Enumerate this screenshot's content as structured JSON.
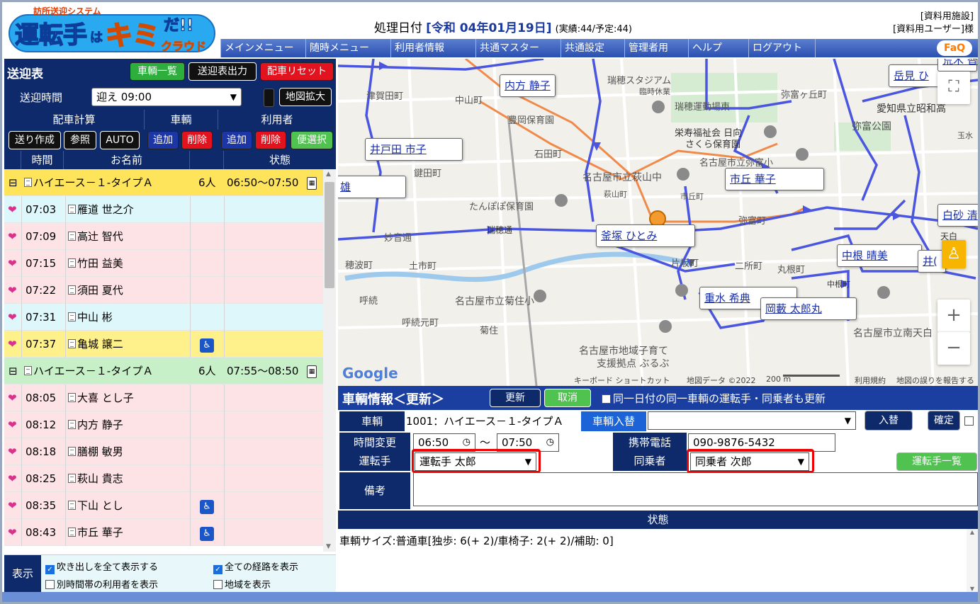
{
  "header": {
    "logo_small": "訪所送迎システム",
    "logo_main_1": "運転手",
    "logo_main_2": "は",
    "logo_main_3": "キミ",
    "logo_main_4": "だ!!",
    "logo_cloud": "クラウド",
    "date_label": "処理日付",
    "date_value": "[令和 04年01月19日]",
    "date_sub": "(実績:44/予定:44)",
    "facility": "[資料用施設]",
    "user": "[資料用ユーザー]様",
    "faq": "FaQ"
  },
  "menu": [
    "メインメニュー",
    "随時メニュー",
    "利用者情報",
    "共通マスター",
    "共通設定",
    "管理者用",
    "ヘルプ",
    "ログアウト"
  ],
  "schedule": {
    "title": "送迎表",
    "btn_vehicle_list": "車輌一覧",
    "btn_output": "送迎表出力",
    "btn_reset": "配車リセット",
    "time_label": "送迎時間",
    "time_value": "迎え 09:00",
    "btn_map_zoom": "地図拡大",
    "calc_label": "配車計算",
    "vehicle_label": "車輌",
    "user_label": "利用者",
    "btn_send": "送り作成",
    "btn_ref": "参照",
    "btn_auto": "AUTO",
    "btn_veh_add": "追加",
    "btn_veh_del": "削除",
    "btn_user_add": "追加",
    "btn_user_del": "削除",
    "btn_convenient": "便選択",
    "col_time": "時間",
    "col_name": "お名前",
    "col_status": "状態",
    "rows": [
      {
        "type": "vehicle",
        "expand": "⊟",
        "name": "ハイエース－１-タイプＡ",
        "count": "6人",
        "status": "06:50～07:50"
      },
      {
        "type": "user",
        "time": "07:03",
        "name": "雁道 世之介",
        "wheel": ""
      },
      {
        "type": "user",
        "time": "07:09",
        "name": "高辻 智代",
        "wheel": ""
      },
      {
        "type": "user",
        "time": "07:15",
        "name": "竹田 益美",
        "wheel": ""
      },
      {
        "type": "user",
        "time": "07:22",
        "name": "須田 夏代",
        "wheel": ""
      },
      {
        "type": "user",
        "time": "07:31",
        "name": "中山 彬",
        "wheel": ""
      },
      {
        "type": "user",
        "time": "07:37",
        "name": "亀城 譲二",
        "wheel": "♿"
      },
      {
        "type": "vehicle",
        "expand": "⊟",
        "name": "ハイエース－１-タイプＡ",
        "count": "6人",
        "status": "07:55～08:50"
      },
      {
        "type": "user",
        "time": "08:05",
        "name": "大喜 とし子",
        "wheel": ""
      },
      {
        "type": "user",
        "time": "08:12",
        "name": "内方 静子",
        "wheel": ""
      },
      {
        "type": "user",
        "time": "08:18",
        "name": "膳棚 敏男",
        "wheel": ""
      },
      {
        "type": "user",
        "time": "08:25",
        "name": "萩山 貴志",
        "wheel": ""
      },
      {
        "type": "user",
        "time": "08:35",
        "name": "下山 とし",
        "wheel": "♿"
      },
      {
        "type": "user",
        "time": "08:43",
        "name": "市丘 華子",
        "wheel": "♿"
      }
    ],
    "display_label": "表示",
    "opt_show_bubbles": "吹き出しを全て表示する",
    "opt_show_routes": "全ての経路を表示",
    "opt_other_time_users": "別時間帯の利用者を表示",
    "opt_show_areas": "地域を表示"
  },
  "map": {
    "pins": [
      "内方 静子",
      "井戸田 市子",
      "雄",
      "市丘 華子",
      "釜塚 ひとみ",
      "中根 晴美",
      "重水 希典",
      "岡藪 太郎丸",
      "岳見 ひ",
      "白砂 清",
      "井(",
      "荒木 智"
    ],
    "labels": [
      "瑞穂スタジアム",
      "臨時休業",
      "瑞穂運動場東",
      "弥富ヶ丘町",
      "愛知県立昭和高",
      "弥富公園",
      "津賀田町",
      "中山町",
      "豊岡保育園",
      "栄寿福祉会 日向",
      "さくら保育園",
      "石田町",
      "鍵田町",
      "名古屋市立弥富小",
      "名古屋市立萩山中",
      "萩山町",
      "市丘町",
      "たんぽぽ保育園",
      "弥富町",
      "瑞穂通",
      "妙音通",
      "土市町",
      "片坂町",
      "二所町",
      "丸根町",
      "中根町",
      "穂波町",
      "呼続",
      "呼続元町",
      "名古屋市立菊住小",
      "菊住",
      "名古屋市立南天白",
      "名古屋市地域子育て",
      "支援拠点 ぶるぶ",
      "天白",
      "玉水"
    ],
    "footer_keyboard": "キーボード ショートカット",
    "footer_mapdata": "地図データ ©2022",
    "footer_scale": "200 m",
    "footer_terms": "利用規約",
    "footer_report": "地図の誤りを報告する",
    "google": "Google"
  },
  "vehicle_info": {
    "title": "車輌情報＜更新＞",
    "btn_update": "更新",
    "btn_cancel": "取消",
    "same_day_update": "同一日付の同一車輌の運転手・同乗者も更新",
    "lbl_vehicle": "車輌",
    "vehicle_value": "1001：ハイエース－１-タイプＡ",
    "btn_vehicle_swap": "車輌入替",
    "btn_swap": "入替",
    "btn_confirm": "確定",
    "lbl_time_change": "時間変更",
    "time_from": "06:50",
    "time_sep": "～",
    "time_to": "07:50",
    "lbl_phone": "携帯電話",
    "phone": "090-9876-5432",
    "lbl_driver": "運転手",
    "driver": "運転手 太郎",
    "lbl_passenger": "同乗者",
    "passenger": "同乗者 次郎",
    "btn_driver_list": "運転手一覧",
    "lbl_note": "備考",
    "lbl_status": "状態",
    "status_text": "車輌サイズ:普通車[独歩: 6(+ 2)/車椅子: 2(+ 2)/補助: 0]"
  },
  "colors": {
    "navy": "#0f2a6a",
    "menu_blue": "#2a4fb0",
    "route_blue": "#4a55e0",
    "route_orange": "#f08a4b",
    "highlight_red": "#e00000"
  }
}
